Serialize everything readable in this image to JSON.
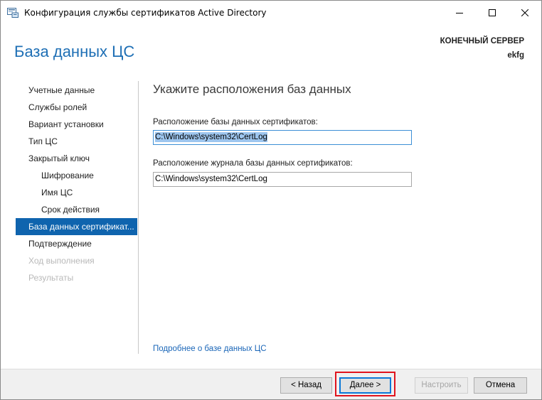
{
  "window": {
    "title": "Конфигурация службы сертификатов Active Directory",
    "icons": {
      "app": "server-config-icon",
      "minimize": "minimize-icon",
      "maximize": "maximize-icon",
      "close": "close-icon"
    }
  },
  "header": {
    "page_title": "База данных ЦС",
    "destination_label": "КОНЕЧНЫЙ СЕРВЕР",
    "destination_value": "ekfg"
  },
  "sidebar": {
    "items": [
      {
        "label": "Учетные данные",
        "state": "normal"
      },
      {
        "label": "Службы ролей",
        "state": "normal"
      },
      {
        "label": "Вариант установки",
        "state": "normal"
      },
      {
        "label": "Тип ЦС",
        "state": "normal"
      },
      {
        "label": "Закрытый ключ",
        "state": "normal"
      },
      {
        "label": "Шифрование",
        "state": "sub"
      },
      {
        "label": "Имя ЦС",
        "state": "sub"
      },
      {
        "label": "Срок действия",
        "state": "sub"
      },
      {
        "label": "База данных сертификат...",
        "state": "active"
      },
      {
        "label": "Подтверждение",
        "state": "normal"
      },
      {
        "label": "Ход выполнения",
        "state": "disabled"
      },
      {
        "label": "Результаты",
        "state": "disabled"
      }
    ]
  },
  "main": {
    "heading": "Укажите расположения баз данных",
    "db_location_label": "Расположение базы данных сертификатов:",
    "db_location_value": "C:\\Windows\\system32\\CertLog",
    "log_location_label": "Расположение журнала базы данных сертификатов:",
    "log_location_value": "C:\\Windows\\system32\\CertLog",
    "more_link": "Подробнее о базе данных ЦС"
  },
  "footer": {
    "back_label": "< Назад",
    "next_label": "Далее >",
    "configure_label": "Настроить",
    "cancel_label": "Отмена"
  },
  "colors": {
    "accent": "#0f64ae",
    "heading": "#1e6fb5",
    "link": "#1a66b8",
    "highlight": "#e0141e",
    "selection": "#9dc5ee"
  }
}
